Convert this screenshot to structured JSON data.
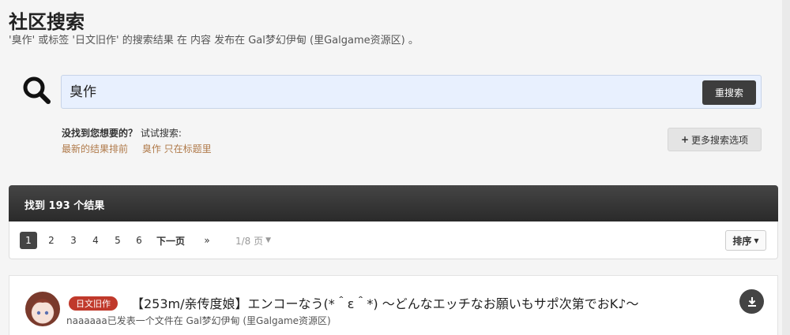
{
  "header": {
    "title": "社区搜索",
    "subtitle": "'臭作' 或标签 '日文旧作' 的搜索结果 在 内容 发布在 Gal梦幻伊甸 (里Galgame资源区) 。"
  },
  "search": {
    "value": "臭作",
    "button_label": "重搜索"
  },
  "hints": {
    "title": "没找到您想要的？",
    "try_label": "试试搜索:",
    "links": [
      "最新的结果排前",
      "臭作 只在标题里"
    ]
  },
  "more_options_label": "更多搜索选项",
  "results": {
    "count_label": "找到 193 个结果"
  },
  "pagination": {
    "pages": [
      "1",
      "2",
      "3",
      "4",
      "5",
      "6"
    ],
    "next_label": "下一页",
    "last_label": "»",
    "total_label": "1/8 页",
    "sort_label": "排序"
  },
  "items": [
    {
      "tag": "日文旧作",
      "title": "【253m/亲传度娘】エンコーなう(*＾ε＾*) ～どんなエッチなお願いもサポ次第でおK♪～",
      "meta": "naaaaaa已发表一个文件在 Gal梦幻伊甸 (里Galgame资源区)"
    }
  ]
}
